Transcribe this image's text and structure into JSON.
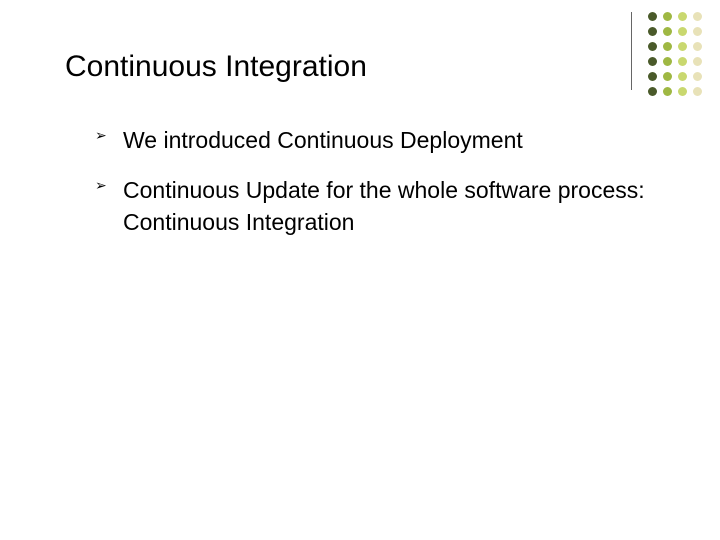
{
  "title": "Continuous Integration",
  "bullets": [
    "We introduced Continuous Deployment",
    "Continuous Update for the whole software process: Continuous Integration"
  ]
}
